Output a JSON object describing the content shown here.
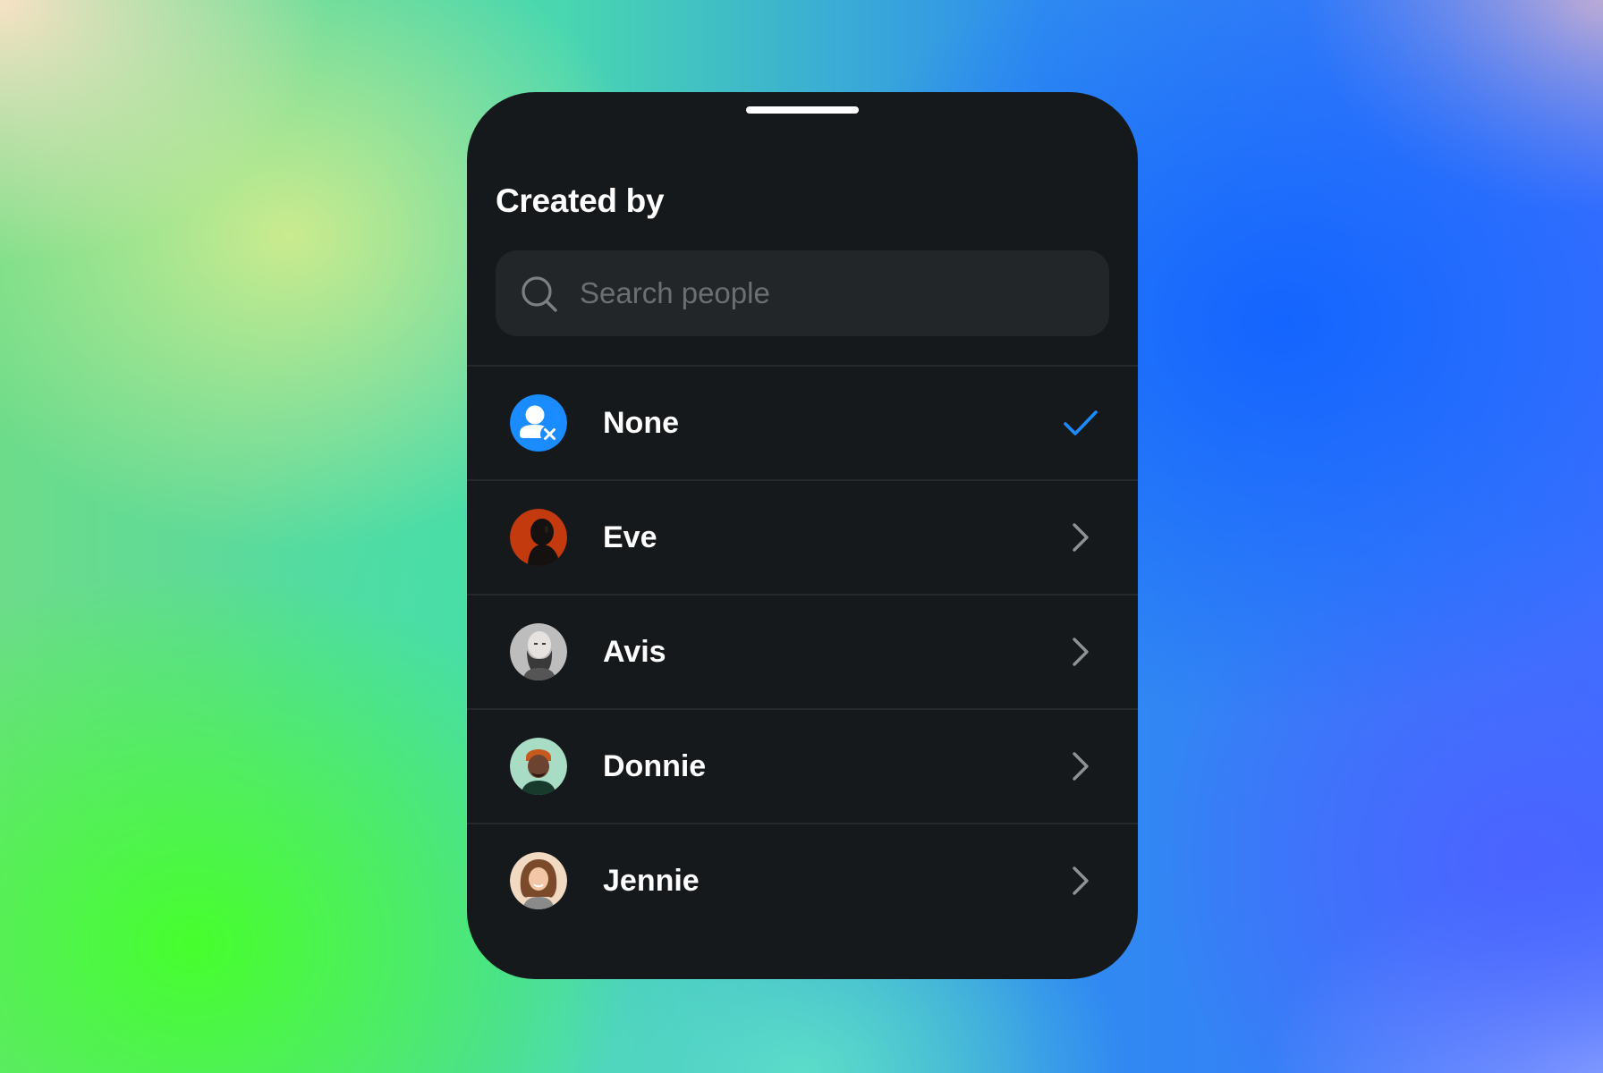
{
  "sheet": {
    "title": "Created by"
  },
  "search": {
    "placeholder": "Search people",
    "value": ""
  },
  "people": [
    {
      "name": "None",
      "avatar": "person-remove-icon",
      "selected": true,
      "trailing_icon": "checkmark-icon"
    },
    {
      "name": "Eve",
      "avatar": "photo",
      "selected": false,
      "trailing_icon": "chevron-right-icon"
    },
    {
      "name": "Avis",
      "avatar": "photo",
      "selected": false,
      "trailing_icon": "chevron-right-icon"
    },
    {
      "name": "Donnie",
      "avatar": "photo",
      "selected": false,
      "trailing_icon": "chevron-right-icon"
    },
    {
      "name": "Jennie",
      "avatar": "photo",
      "selected": false,
      "trailing_icon": "chevron-right-icon"
    }
  ],
  "colors": {
    "sheet_background": "#16191b",
    "search_background": "#232628",
    "accent": "#1a8cff",
    "chevron": "#8e9296",
    "placeholder": "#6a6f73"
  }
}
